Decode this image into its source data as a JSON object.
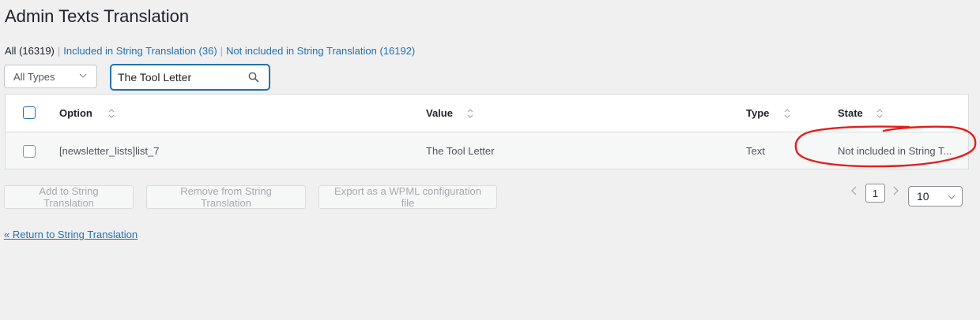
{
  "page": {
    "title": "Admin Texts Translation"
  },
  "filters": {
    "all_label": "All",
    "all_count": "(16319)",
    "included_label": "Included in String Translation (36)",
    "not_included_label": "Not included in String Translation (16192)",
    "separator": "|"
  },
  "type_select": {
    "selected": "All Types"
  },
  "search": {
    "value": "The Tool Letter"
  },
  "table": {
    "columns": {
      "option": "Option",
      "value": "Value",
      "type": "Type",
      "state": "State"
    },
    "rows": [
      {
        "option": "[newsletter_lists]list_7",
        "value": "The Tool Letter",
        "type": "Text",
        "state": "Not included in String T..."
      }
    ]
  },
  "actions": {
    "add": "Add to String Translation",
    "remove": "Remove from String Translation",
    "export": "Export as a WPML configuration file"
  },
  "pagination": {
    "current_page": "1",
    "per_page": "10"
  },
  "return_link": "« Return to String Translation",
  "colors": {
    "accent": "#2271b1",
    "annotation": "#e0201b",
    "background": "#f0f0f1"
  }
}
